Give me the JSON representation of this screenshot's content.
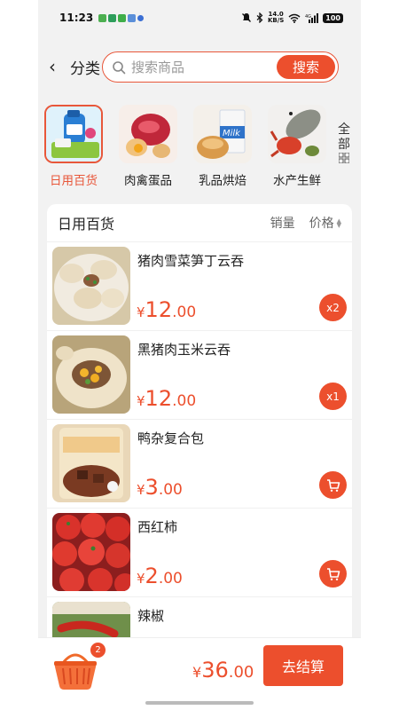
{
  "status_bar": {
    "time": "11:23",
    "net_speed_top": "14.0",
    "net_speed_unit": "KB/S",
    "battery": "100"
  },
  "header": {
    "back_label": "分类",
    "search_placeholder": "搜索商品",
    "search_button": "搜索"
  },
  "categories": [
    {
      "label": "日用百货",
      "active": true
    },
    {
      "label": "肉禽蛋品",
      "active": false
    },
    {
      "label": "乳品烘焙",
      "active": false
    },
    {
      "label": "水产生鲜",
      "active": false
    }
  ],
  "all_categories_label": "全部",
  "list": {
    "title": "日用百货",
    "sort_sales": "销量",
    "sort_price": "价格",
    "products": [
      {
        "name": "猪肉雪菜笋丁云吞",
        "price_symbol": "¥",
        "price_int": "12",
        "price_dec": ".00",
        "action": "x2"
      },
      {
        "name": "黑猪肉玉米云吞",
        "price_symbol": "¥",
        "price_int": "12",
        "price_dec": ".00",
        "action": "x1"
      },
      {
        "name": "鸭杂复合包",
        "price_symbol": "¥",
        "price_int": "3",
        "price_dec": ".00",
        "action": "cart-icon"
      },
      {
        "name": "西红柿",
        "price_symbol": "¥",
        "price_int": "2",
        "price_dec": ".00",
        "action": "cart-icon"
      },
      {
        "name": "辣椒",
        "price_symbol": "¥",
        "price_int": "",
        "price_dec": "",
        "action": ""
      }
    ]
  },
  "cart": {
    "count": "2",
    "total_symbol": "¥",
    "total_int": "36",
    "total_dec": ".00",
    "checkout_label": "去结算"
  },
  "colors": {
    "accent": "#ec4f2d",
    "background": "#f2f2f2"
  }
}
